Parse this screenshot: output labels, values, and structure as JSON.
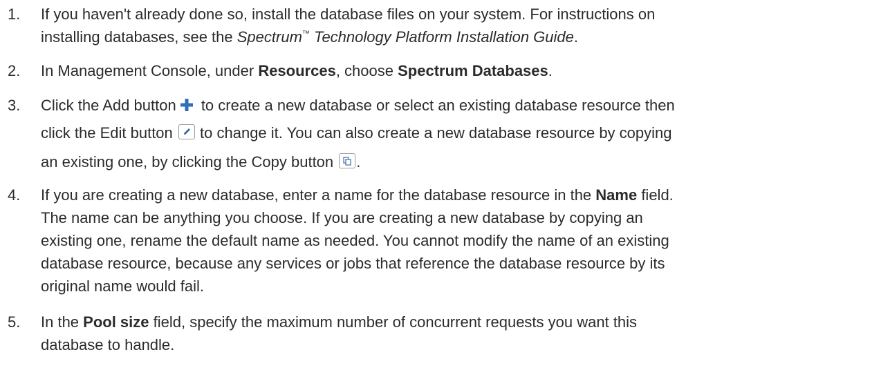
{
  "steps": [
    {
      "number": "1.",
      "line1": "If you haven't already done so, install the database files on your system. For instructions on",
      "line2a": "installing databases, see the ",
      "guide_pre": "Spectrum",
      "tm": "™",
      "guide_post": " Technology Platform Installation Guide",
      "line2b": "."
    },
    {
      "number": "2.",
      "a": "In Management Console, under ",
      "b1": "Resources",
      "c": ", choose ",
      "b2": "Spectrum Databases",
      "d": "."
    },
    {
      "number": "3.",
      "a": "Click the Add button",
      "b": "to create a new database or select an existing database resource then",
      "c": "click the Edit button",
      "d": "to change it. You can also create a new database resource by copying",
      "e": "an existing one, by clicking the Copy button",
      "f": "."
    },
    {
      "number": "4.",
      "a": "If you are creating a new database, enter a name for the database resource in the ",
      "b": "Name",
      "c": " field.",
      "l2": "The name can be anything you choose. If you are creating a new database by copying an",
      "l3": "existing one, rename the default name as needed. You cannot modify the name of an existing",
      "l4": "database resource, because any services or jobs that reference the database resource by its",
      "l5": "original name would fail."
    },
    {
      "number": "5.",
      "a": "In the ",
      "b": "Pool size",
      "c": " field, specify the maximum number of concurrent requests you want this",
      "l2": "database to handle."
    }
  ],
  "icons": {
    "add": "plus-icon",
    "edit": "pencil-icon",
    "copy": "copy-icon",
    "accent": "#2e6fb7"
  }
}
